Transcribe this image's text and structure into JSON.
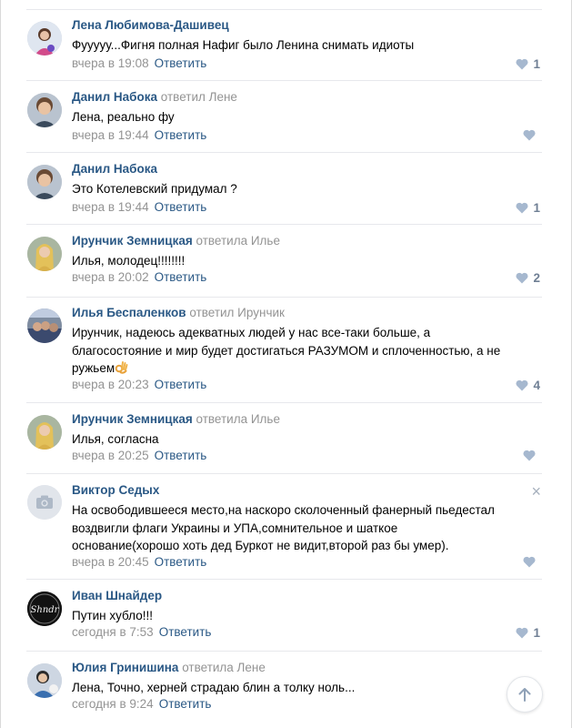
{
  "colors": {
    "link": "#2a5885",
    "muted": "#939393",
    "like": "#6f7f94",
    "divider": "#e7e8ec"
  },
  "comments": [
    {
      "author": "Лена Любимова-Дашивец",
      "replied_to": "",
      "text": "Фууууу...Фигня полная Нафиг было Ленина снимать идиоты",
      "date": "вчера в 19:08",
      "reply": "Ответить",
      "likes": "1",
      "avatar": "girl-photo"
    },
    {
      "author": "Данил Набока",
      "replied_to": "ответил Лене",
      "text": "Лена, реально фу",
      "date": "вчера в 19:44",
      "reply": "Ответить",
      "likes": "",
      "avatar": "boy-photo"
    },
    {
      "author": "Данил Набока",
      "replied_to": "",
      "text": "Это Котелевский придумал ?",
      "date": "вчера в 19:44",
      "reply": "Ответить",
      "likes": "1",
      "avatar": "boy-photo"
    },
    {
      "author": "Ирунчик Земницкая",
      "replied_to": "ответила Илье",
      "text": "Илья, молодец!!!!!!!!",
      "date": "вчера в 20:02",
      "reply": "Ответить",
      "likes": "2",
      "avatar": "blonde-photo"
    },
    {
      "author": "Илья Беспаленков",
      "replied_to": "ответил Ирунчик",
      "text_lines": [
        "Ирунчик, надеюсь адекватных людей у нас все-таки больше, а",
        "благосостояние и мир будет достигаться РАЗУМОМ и сплоченностью, а не",
        "ружьем"
      ],
      "date": "вчера в 20:23",
      "reply": "Ответить",
      "likes": "4",
      "avatar": "group-photo"
    },
    {
      "author": "Ирунчик Земницкая",
      "replied_to": "ответила Илье",
      "text": "Илья, согласна",
      "date": "вчера в 20:25",
      "reply": "Ответить",
      "likes": "",
      "avatar": "blonde-photo"
    },
    {
      "author": "Виктор Седых",
      "replied_to": "",
      "text_lines": [
        "На освободившееся место,на наскоро сколоченный фанерный пьедестал",
        "воздвигли флаги Украины и УПА,сомнительное и шаткое",
        "основание(хорошо хоть дед Буркот не видит,второй раз бы умер)."
      ],
      "date": "вчера в 20:45",
      "reply": "Ответить",
      "likes": "",
      "avatar": "camera-placeholder"
    },
    {
      "author": "Иван Шнайдер",
      "replied_to": "",
      "text": "Путин хубло!!!",
      "date": "сегодня в 7:53",
      "reply": "Ответить",
      "likes": "1",
      "avatar": "logo-shndr"
    },
    {
      "author": "Юлия Гринишина",
      "replied_to": "ответила Лене",
      "text": "Лена, Точно, херней страдаю блин а толку ноль...",
      "date": "сегодня в 9:24",
      "reply": "Ответить",
      "likes": "",
      "avatar": "woman-photo"
    }
  ],
  "avatar_logo_text": "Shndr",
  "close_symbol": "×"
}
